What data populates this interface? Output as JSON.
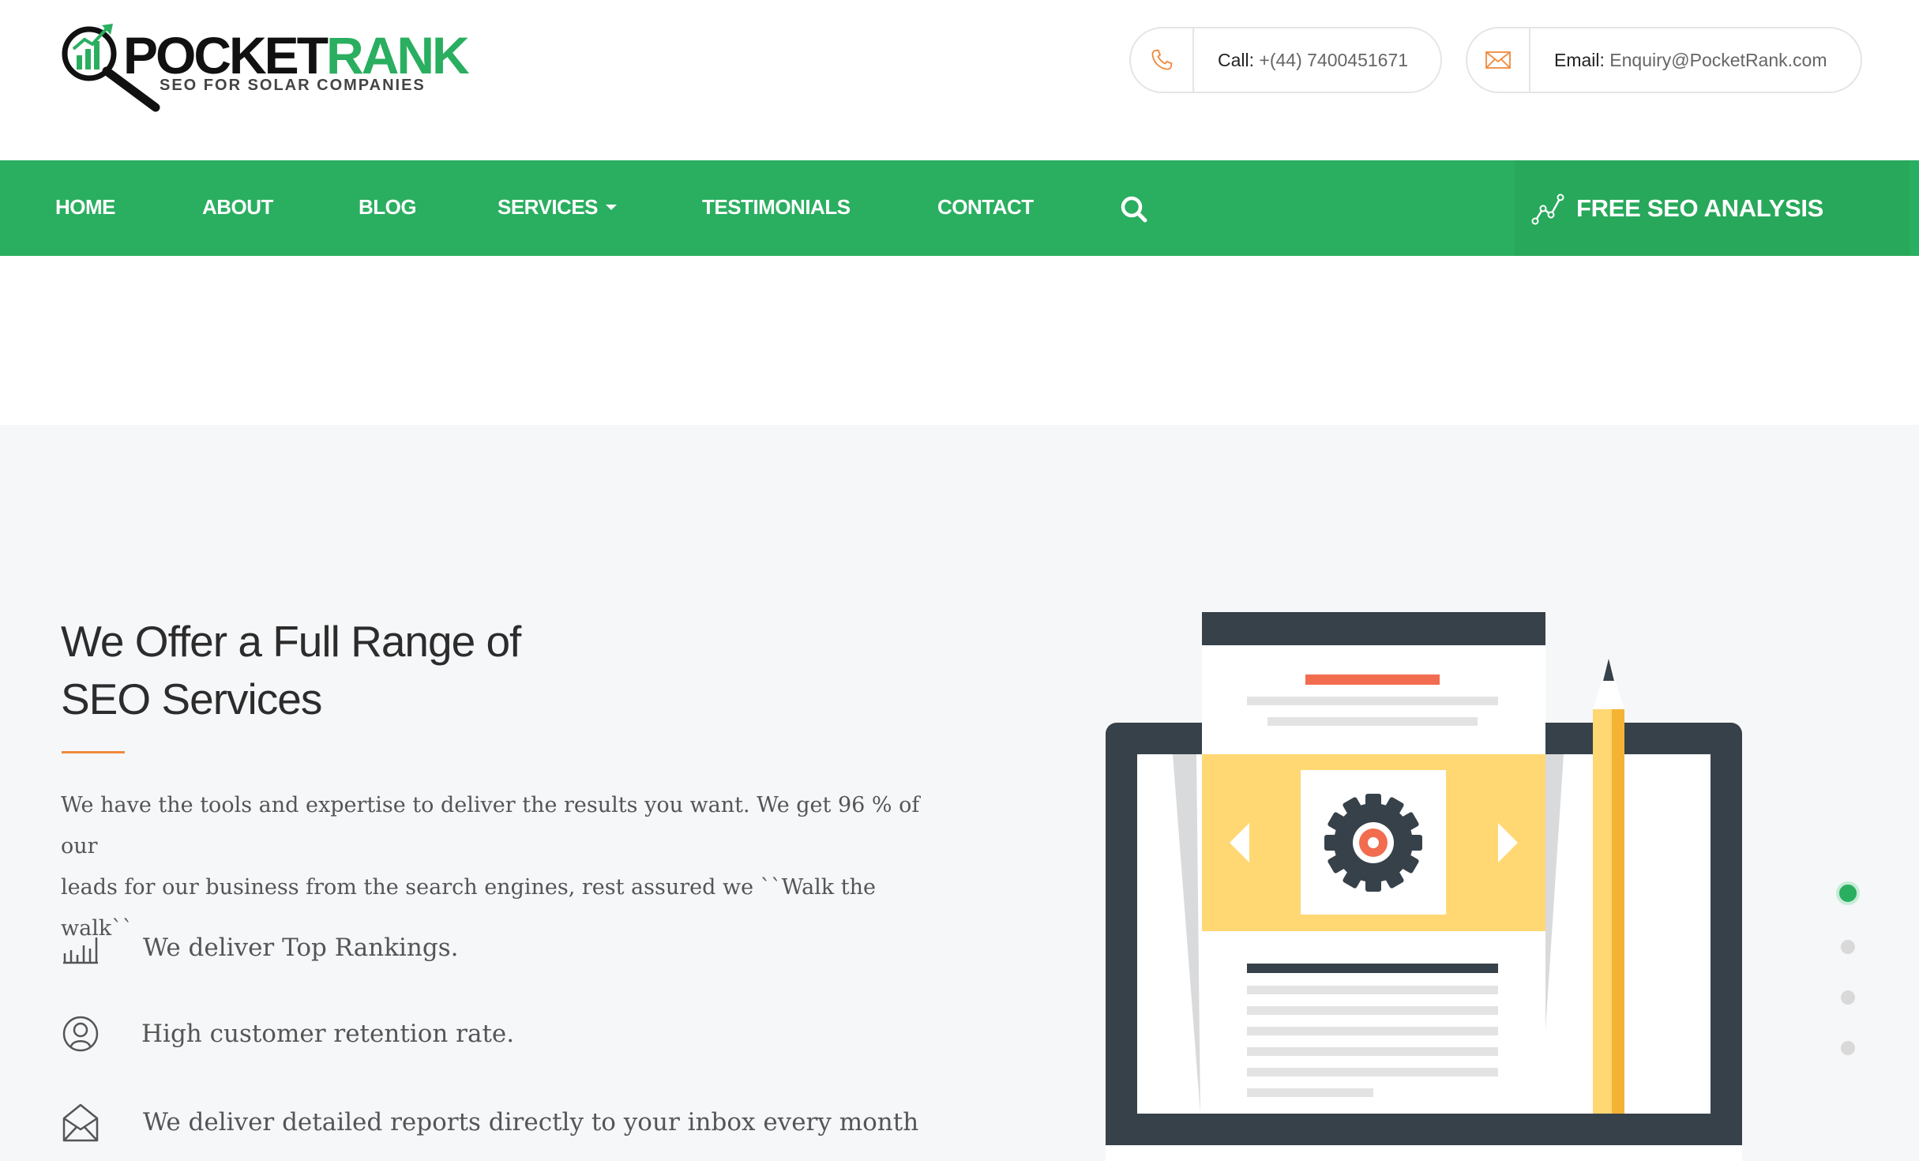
{
  "brand": {
    "logo_part1": "POCKET",
    "logo_part2": "RANK",
    "tagline": "SEO FOR SOLAR COMPANIES",
    "color_primary": "#2aae60",
    "color_accent": "#ef8a3c"
  },
  "contact": {
    "call_label": "Call:",
    "call_value": "+(44) 7400451671",
    "call_icon": "phone-icon",
    "email_label": "Email:",
    "email_value": "Enquiry@PocketRank.com",
    "email_icon": "envelope-icon"
  },
  "nav": {
    "items": [
      {
        "label": "HOME"
      },
      {
        "label": "ABOUT"
      },
      {
        "label": "BLOG"
      },
      {
        "label": "SERVICES"
      },
      {
        "label": "TESTIMONIALS"
      },
      {
        "label": "CONTACT"
      }
    ],
    "search_icon": "search-icon",
    "cta_label": "FREE SEO ANALYSIS",
    "cta_icon": "line-chart-icon"
  },
  "hero": {
    "heading_line1": "We Offer a Full Range of",
    "heading_line2": "SEO Services",
    "intro_line1": "We have the tools and expertise to deliver the results you want. We get 96 % of our",
    "intro_line2": "leads for our business from the search engines, rest assured we ``Walk the walk``",
    "features": [
      {
        "icon": "bar-chart-icon",
        "text": "We deliver Top Rankings."
      },
      {
        "icon": "user-circle-icon",
        "text": "High customer retention rate."
      },
      {
        "icon": "open-envelope-icon",
        "text": "We deliver detailed reports directly to your inbox every month"
      }
    ]
  },
  "slider": {
    "slide_count": 4,
    "active_index": 0
  }
}
